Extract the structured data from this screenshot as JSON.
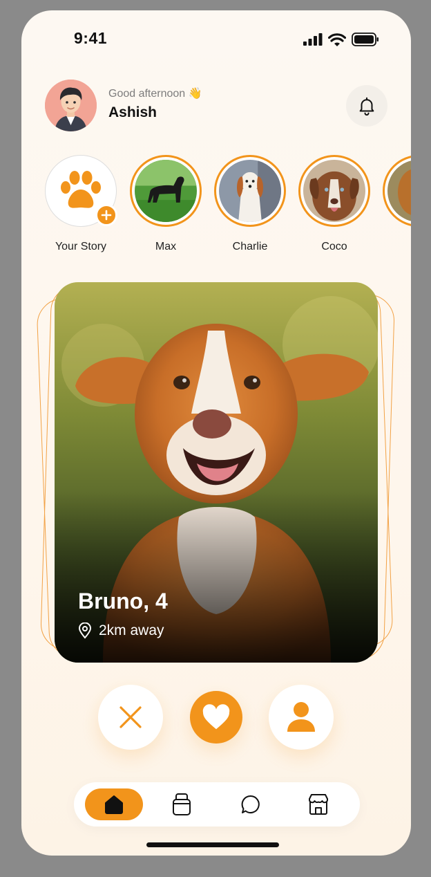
{
  "status": {
    "time": "9:41"
  },
  "header": {
    "greeting": "Good afternoon 👋",
    "user_name": "Ashish"
  },
  "stories": [
    {
      "label": "Your Story"
    },
    {
      "label": "Max"
    },
    {
      "label": "Charlie"
    },
    {
      "label": "Coco"
    }
  ],
  "card": {
    "name_age": "Bruno, 4",
    "distance": "2km away"
  },
  "colors": {
    "accent": "#f2941b",
    "background": "#fdf6ec"
  },
  "nav": {
    "items": [
      "home-icon",
      "bag-icon",
      "chat-icon",
      "store-icon"
    ],
    "active": "home-icon"
  }
}
